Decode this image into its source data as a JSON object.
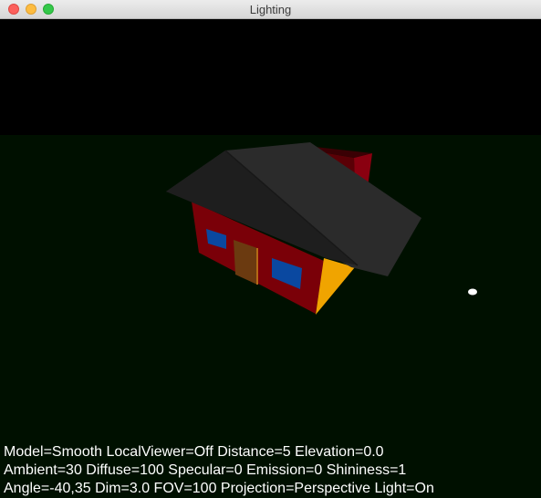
{
  "window": {
    "title": "Lighting"
  },
  "icons": {
    "close": "close-icon",
    "minimize": "minimize-icon",
    "maximize": "maximize-icon"
  },
  "colors": {
    "sky": "#000000",
    "ground": "#001000",
    "roof": "#2b2b2b",
    "walls": "#7a0008",
    "window_glass": "#0a48a0",
    "door": "#6b3a10",
    "gable_lit": "#f0a400",
    "light": "#ffffff"
  },
  "hud": {
    "line1": "Model=Smooth LocalViewer=Off Distance=5 Elevation=0.0",
    "line2": "Ambient=30  Diffuse=100 Specular=0 Emission=0 Shininess=1",
    "line3": "Angle=-40,35  Dim=3.0 FOV=100 Projection=Perspective Light=On"
  }
}
